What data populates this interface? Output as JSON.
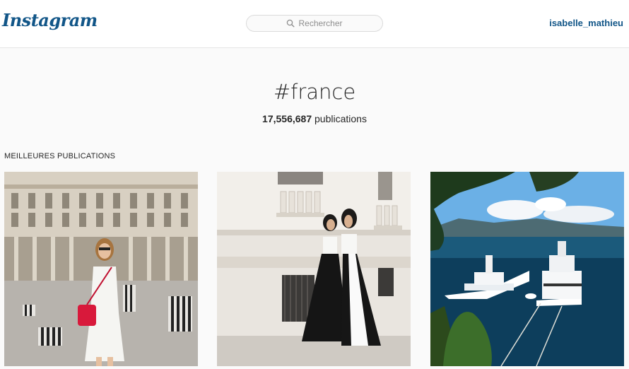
{
  "header": {
    "logo_text": "Instagram",
    "search_placeholder": "Rechercher",
    "username": "isabelle_mathieu"
  },
  "tag": {
    "name": "#france",
    "count": "17,556,687",
    "count_label": " publications"
  },
  "section": {
    "title": "MEILLEURES PUBLICATIONS"
  },
  "colors": {
    "brand": "#125688",
    "background": "#fafafa"
  },
  "icons": {
    "search": "magnifier-icon"
  }
}
